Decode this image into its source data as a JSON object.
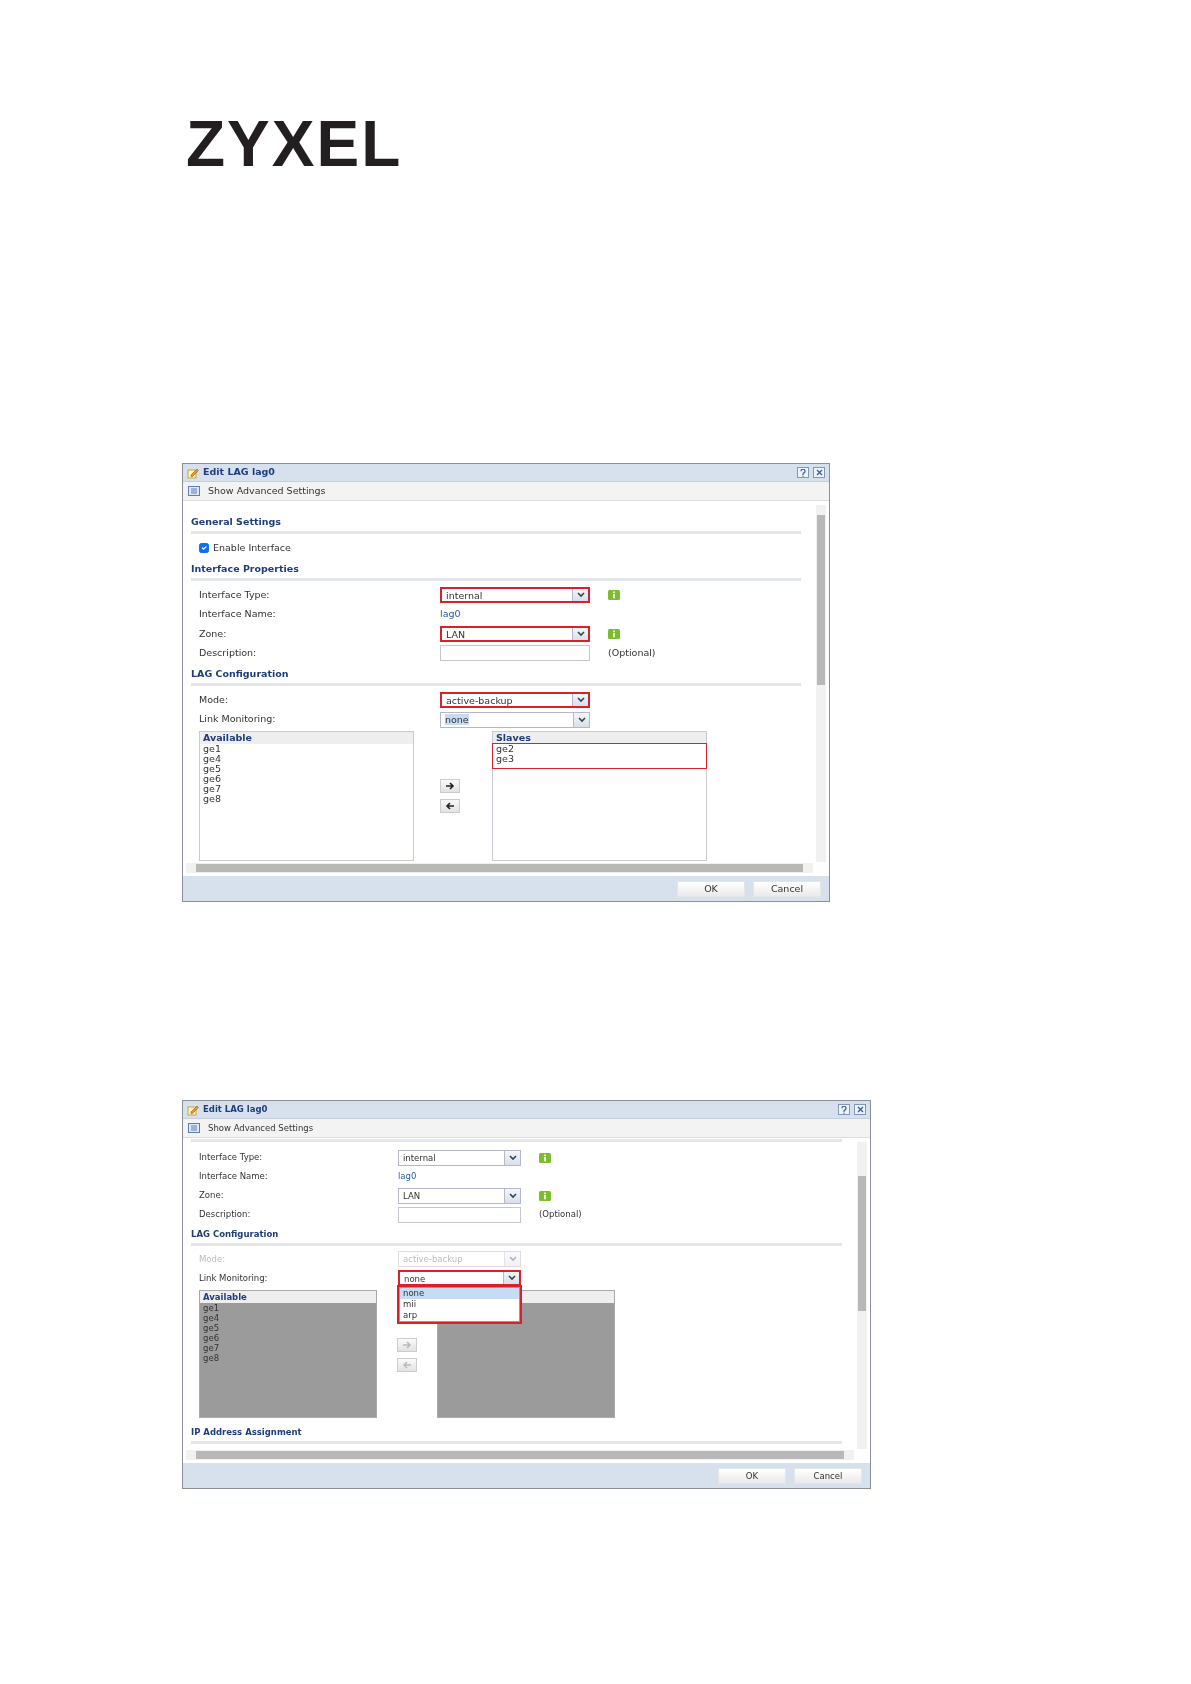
{
  "logo": "ZYXEL",
  "dialogs": [
    {
      "title": "Edit LAG lag0",
      "toolbar": "Show Advanced Settings",
      "scrolled": false,
      "sections": [
        {
          "heading": "General Settings",
          "rows": [
            {
              "kind": "checkbox",
              "label": "Enable Interface",
              "checked": true
            }
          ]
        },
        {
          "heading": "Interface Properties",
          "rows": [
            {
              "kind": "select",
              "label": "Interface Type:",
              "value": "internal",
              "highlighted": true,
              "info": true,
              "disabled": false
            },
            {
              "kind": "link",
              "label": "Interface Name:",
              "value": "lag0"
            },
            {
              "kind": "select",
              "label": "Zone:",
              "value": "LAN",
              "highlighted": true,
              "info": true,
              "disabled": false
            },
            {
              "kind": "input",
              "label": "Description:",
              "note": "(Optional)"
            }
          ]
        },
        {
          "heading": "LAG Configuration",
          "rows": [
            {
              "kind": "select",
              "label": "Mode:",
              "value": "active-backup",
              "highlighted": true,
              "disabled": false
            },
            {
              "kind": "select",
              "label": "Link Monitoring:",
              "value": "none",
              "highlighted": false,
              "disabled": false,
              "value_selected": true
            },
            {
              "kind": "duallist",
              "disabled": false,
              "available": {
                "header": "Available",
                "items": [
                  "ge1",
                  "ge4",
                  "ge5",
                  "ge6",
                  "ge7",
                  "ge8"
                ]
              },
              "slaves": {
                "header": "Slaves",
                "items": [
                  "ge2",
                  "ge3"
                ],
                "highlighted": true
              }
            }
          ]
        }
      ],
      "buttons": [
        "OK",
        "Cancel"
      ]
    },
    {
      "title": "Edit LAG lag0",
      "toolbar": "Show Advanced Settings",
      "scrolled": true,
      "sections": [
        {
          "rows": [
            {
              "kind": "select",
              "label": "Interface Type:",
              "value": "internal",
              "highlighted": false,
              "info": true,
              "disabled": false
            },
            {
              "kind": "link",
              "label": "Interface Name:",
              "value": "lag0"
            },
            {
              "kind": "select",
              "label": "Zone:",
              "value": "LAN",
              "highlighted": false,
              "info": true,
              "disabled": false
            },
            {
              "kind": "input",
              "label": "Description:",
              "note": "(Optional)"
            }
          ]
        },
        {
          "heading": "LAG Configuration",
          "rows": [
            {
              "kind": "select",
              "label": "Mode:",
              "value": "active-backup",
              "highlighted": false,
              "disabled": true
            },
            {
              "kind": "select",
              "label": "Link Monitoring:",
              "value": "none",
              "highlighted": true,
              "disabled": false,
              "options": [
                {
                  "label": "none",
                  "selected": true
                },
                {
                  "label": "mii",
                  "selected": false
                },
                {
                  "label": "arp",
                  "selected": false
                }
              ]
            },
            {
              "kind": "duallist",
              "disabled": true,
              "available": {
                "header": "Available",
                "items": [
                  "ge1",
                  "ge4",
                  "ge5",
                  "ge6",
                  "ge7",
                  "ge8"
                ]
              },
              "slaves": {}
            }
          ]
        },
        {
          "heading": "IP Address Assignment"
        }
      ],
      "buttons": [
        "OK",
        "Cancel"
      ]
    }
  ]
}
